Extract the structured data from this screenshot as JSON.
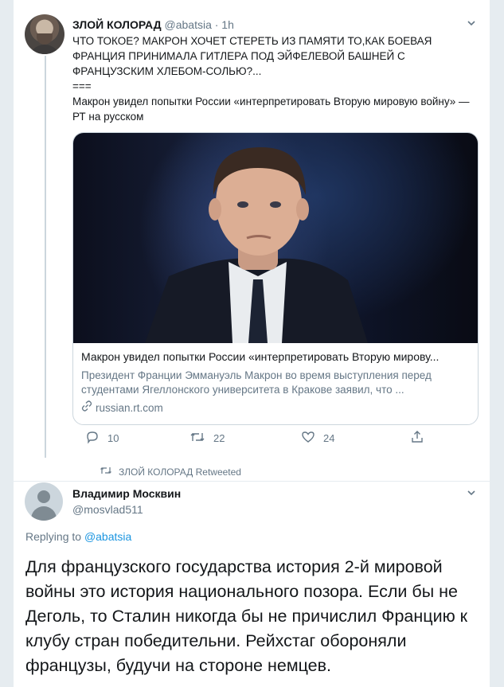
{
  "tweet1": {
    "author_name": "ЗЛОЙ КОЛОРАД",
    "handle": "@abatsia",
    "time": "· 1h",
    "text": "ЧТО ТОКОЕ? МАКРОН ХОЧЕТ СТЕРЕТЬ ИЗ ПАМЯТИ ТО,КАК БОЕВАЯ ФРАНЦИЯ ПРИНИМАЛА ГИТЛЕРА ПОД ЭЙФЕЛЕВОЙ БАШНЕЙ С ФРАНЦУЗСКИМ ХЛЕБОМ-СОЛЬЮ?...\n===\nМакрон увидел попытки России «интерпретировать Вторую мировую войну» — РТ на русском",
    "card": {
      "title": "Макрон увидел попытки России «интерпретировать Вторую мирову...",
      "description": "Президент Франции Эммануэль Макрон во время выступления перед студентами Ягеллонского университета в Кракове заявил, что ...",
      "domain": "russian.rt.com"
    },
    "replies": "10",
    "retweets": "22",
    "likes": "24"
  },
  "retweet_notice": "ЗЛОЙ КОЛОРАД Retweeted",
  "tweet2": {
    "author_name": "Владимир Москвин",
    "handle": "@mosvlad511",
    "replying_prefix": "Replying to",
    "replying_to": "@abatsia",
    "text": "Для французского государства история 2-й мировой войны это история национального позора. Если бы не Деголь, то Сталин никогда бы не причислил Францию к клубу стран победительни. Рейхстаг обороняли французы, будучи на стороне немцев."
  },
  "colors": {
    "accent": "#1b95e0",
    "muted": "#657786",
    "border": "#ccd6dd"
  }
}
